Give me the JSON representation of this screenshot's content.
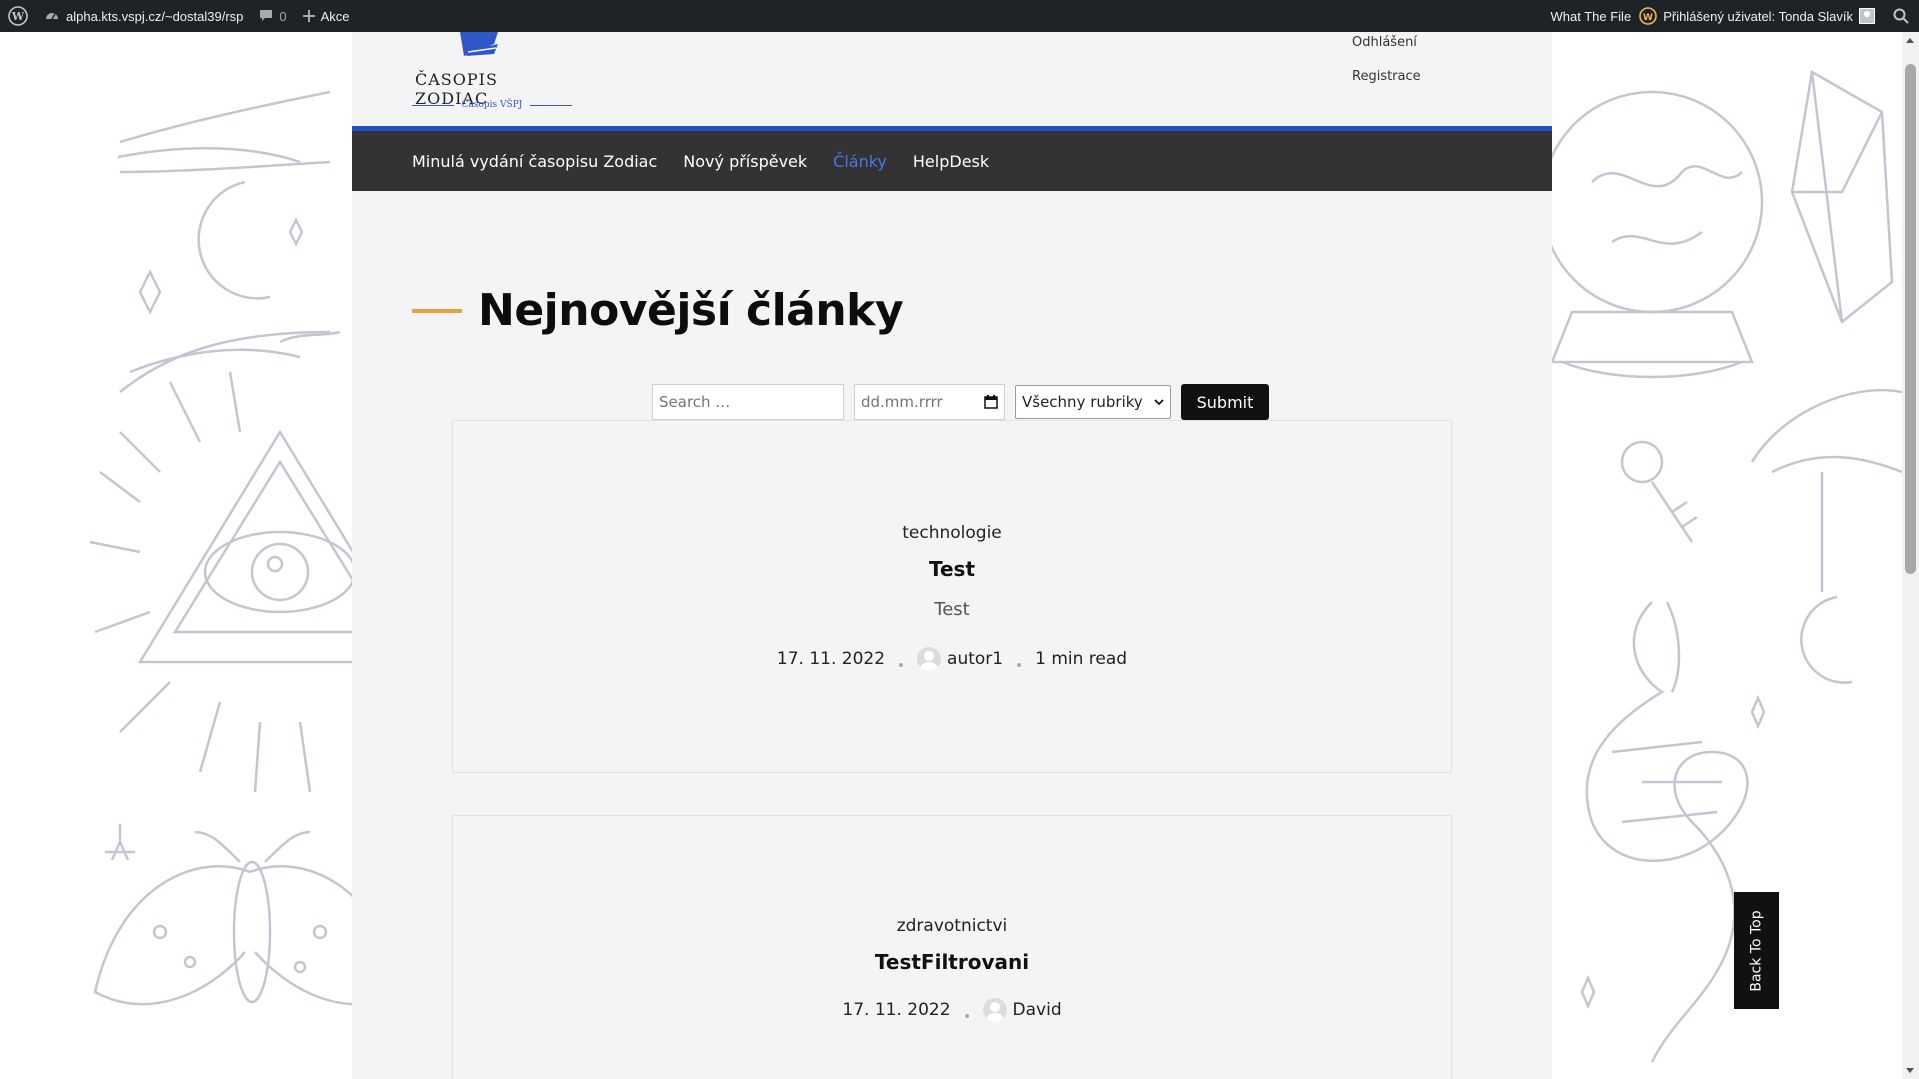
{
  "adminbar": {
    "site_name": "alpha.kts.vspj.cz/~dostal39/rsp",
    "comments_count": "0",
    "new_label": "Akce",
    "plugin_label": "What The File",
    "user_greeting": "Přihlášený uživatel: Tonda Slavík"
  },
  "header": {
    "logo_title": "ČASOPIS ZODIAC",
    "logo_subtitle": "Časopis VŠPJ",
    "account_links": [
      "Odhlášení",
      "Registrace"
    ]
  },
  "nav": {
    "items": [
      {
        "label": "Minulá vydání časopisu Zodiac",
        "active": false
      },
      {
        "label": "Nový příspěvek",
        "active": false
      },
      {
        "label": "Články",
        "active": true
      },
      {
        "label": "HelpDesk",
        "active": false
      }
    ]
  },
  "main": {
    "heading": "Nejnovější články",
    "filters": {
      "search_placeholder": "Search …",
      "date_placeholder": "dd.mm.rrrr",
      "category_selected": "Všechny rubriky",
      "submit_label": "Submit"
    },
    "posts": [
      {
        "category": "technologie",
        "title": "Test",
        "excerpt": "Test",
        "date": "17. 11. 2022",
        "author": "autor1",
        "read_time": "1 min read"
      },
      {
        "category": "zdravotnictvi",
        "title": "TestFiltrovani",
        "date": "17. 11. 2022",
        "author": "David"
      }
    ]
  },
  "back_to_top": "Back To Top",
  "colors": {
    "accent_blue": "#1f4fc2",
    "nav_bg": "#333333",
    "active_link": "#4a78e8",
    "heading_bar": "#e3a23e"
  }
}
